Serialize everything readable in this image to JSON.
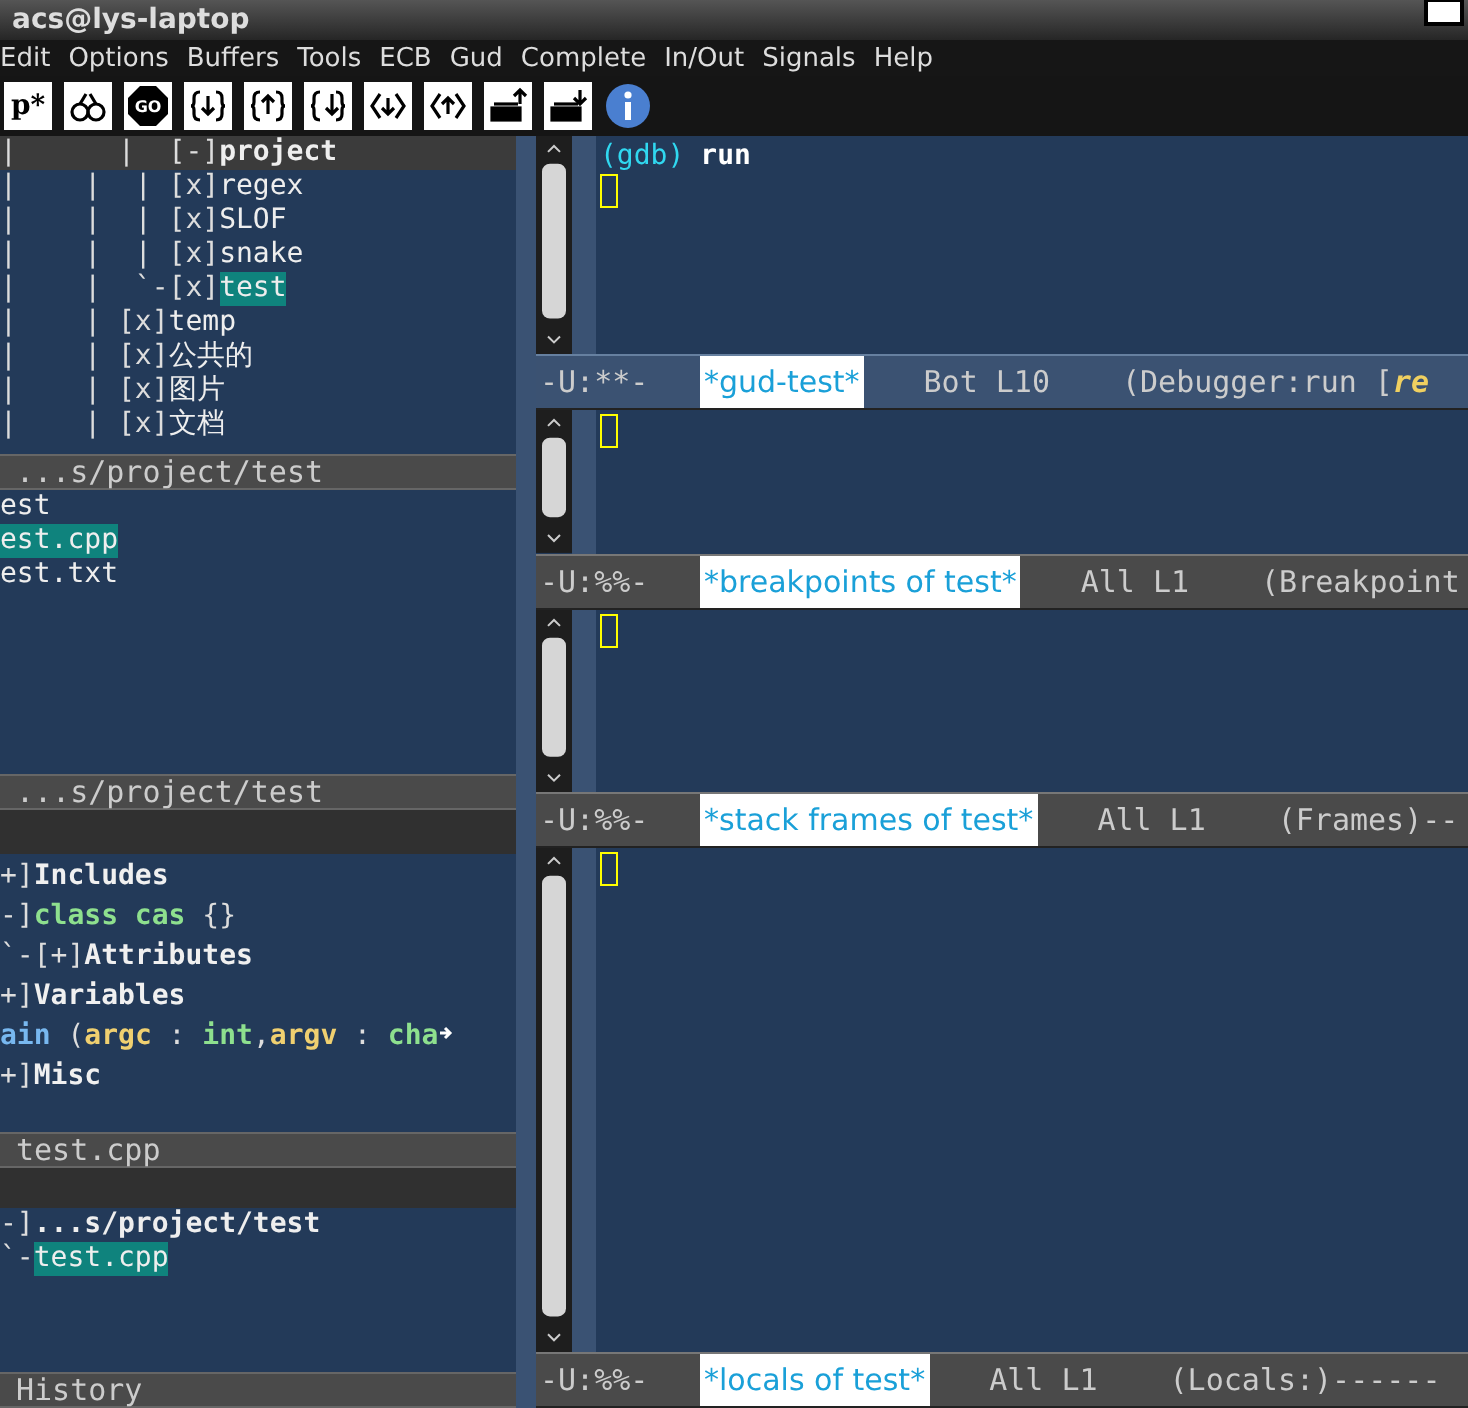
{
  "window": {
    "title": "acs@lys-laptop"
  },
  "menu": [
    "Edit",
    "Options",
    "Buffers",
    "Tools",
    "ECB",
    "Gud",
    "Complete",
    "In/Out",
    "Signals",
    "Help"
  ],
  "toolbar": [
    {
      "kind": "text",
      "label": "p*"
    },
    {
      "kind": "glasses"
    },
    {
      "kind": "stop",
      "label": "GO"
    },
    {
      "kind": "braces-down"
    },
    {
      "kind": "braces-up"
    },
    {
      "kind": "braces-next"
    },
    {
      "kind": "angle-down"
    },
    {
      "kind": "angle-up"
    },
    {
      "kind": "tray-up"
    },
    {
      "kind": "tray-down"
    },
    {
      "kind": "info"
    }
  ],
  "ecb": {
    "directories": {
      "items": [
        {
          "prefix": "|      |  [-]",
          "label": "project",
          "selected": false,
          "children": [
            {
              "prefix": "|    |  | [x]",
              "label": "regex",
              "selected": false
            },
            {
              "prefix": "|    |  | [x]",
              "label": "SLOF",
              "selected": false
            },
            {
              "prefix": "|    |  | [x]",
              "label": "snake",
              "selected": false
            },
            {
              "prefix": "|    |  `-[x]",
              "label": "test",
              "selected": true
            }
          ]
        },
        {
          "prefix": "|    | [x]",
          "label": "temp",
          "selected": false
        },
        {
          "prefix": "|    | [x]",
          "label": "公共的",
          "selected": false
        },
        {
          "prefix": "|    | [x]",
          "label": "图片",
          "selected": false
        },
        {
          "prefix": "|    | [x]",
          "label": "文档",
          "selected": false
        }
      ],
      "mode_line": "...s/project/test"
    },
    "sources": {
      "items": [
        {
          "label": "est",
          "selected": false
        },
        {
          "label": "est.cpp",
          "selected": true
        },
        {
          "label": "est.txt",
          "selected": false
        }
      ],
      "mode_line": "...s/project/test"
    },
    "methods": {
      "lines": [
        {
          "truncated": false,
          "tokens": [
            {
              "text": "+]",
              "kind": "mark"
            },
            {
              "text": "Includes",
              "kind": "heading"
            }
          ]
        },
        {
          "truncated": false,
          "tokens": [
            {
              "text": "-]",
              "kind": "mark"
            },
            {
              "text": "class cas",
              "kind": "keyword"
            },
            {
              "text": " {}",
              "kind": "punct"
            }
          ]
        },
        {
          "truncated": false,
          "tokens": [
            {
              "text": "`-[+]",
              "kind": "mark"
            },
            {
              "text": "Attributes",
              "kind": "heading"
            }
          ]
        },
        {
          "truncated": false,
          "tokens": [
            {
              "text": "+]",
              "kind": "mark"
            },
            {
              "text": "Variables",
              "kind": "heading"
            }
          ]
        },
        {
          "truncated": true,
          "tokens": [
            {
              "text": "ain",
              "kind": "func"
            },
            {
              "text": " (",
              "kind": "punct"
            },
            {
              "text": "argc",
              "kind": "param"
            },
            {
              "text": " : ",
              "kind": "punct"
            },
            {
              "text": "int",
              "kind": "type"
            },
            {
              "text": ",",
              "kind": "punct"
            },
            {
              "text": "argv",
              "kind": "param"
            },
            {
              "text": " : ",
              "kind": "punct"
            },
            {
              "text": "cha",
              "kind": "type"
            }
          ]
        },
        {
          "truncated": false,
          "tokens": [
            {
              "text": "+]",
              "kind": "mark"
            },
            {
              "text": "Misc",
              "kind": "heading"
            }
          ]
        }
      ],
      "mode_line": "test.cpp"
    },
    "history": {
      "items": [
        {
          "prefix": "-]",
          "label": "...s/project/test",
          "selected": false,
          "children": [
            {
              "prefix": "`-",
              "label": "test.cpp",
              "selected": true
            }
          ]
        }
      ],
      "mode_line": "History"
    }
  },
  "windows": [
    {
      "active": true,
      "content": [
        {
          "text": "(gdb)",
          "kind": "prompt"
        },
        {
          "text": "run",
          "kind": "input"
        }
      ],
      "mode_line": {
        "status": "-U:**-",
        "buffer": "*gud-test*",
        "position": "Bot L10",
        "mode": "(Debugger:run [",
        "extra": "re"
      }
    },
    {
      "active": false,
      "mode_line": {
        "status": "-U:%%-",
        "buffer": "*breakpoints of test*",
        "position": "All L1",
        "mode": "(Breakpoint"
      }
    },
    {
      "active": false,
      "mode_line": {
        "status": "-U:%%-",
        "buffer": "*stack frames of test*",
        "position": "All L1",
        "mode": "(Frames)--"
      }
    },
    {
      "active": false,
      "mode_line": {
        "status": "-U:%%-",
        "buffer": "*locals of test*",
        "position": "All L1",
        "mode": "(Locals:)------"
      }
    }
  ]
}
